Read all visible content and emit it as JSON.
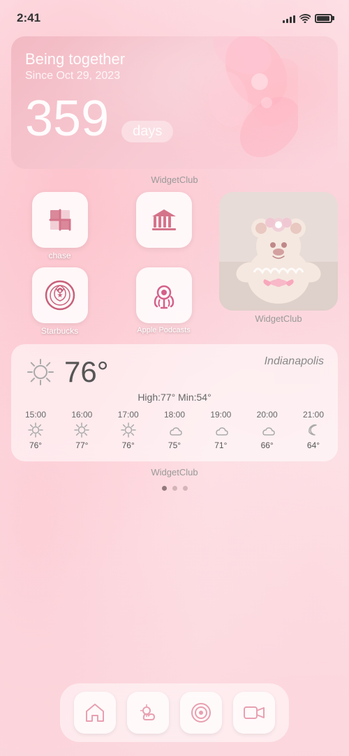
{
  "statusBar": {
    "time": "2:41",
    "signalBars": [
      3,
      5,
      7,
      9,
      11
    ],
    "batteryLevel": 85
  },
  "relationshipWidget": {
    "title": "Being together",
    "subtitle": "Since Oct 29, 2023",
    "count": "359",
    "unit": "days",
    "widgetclubLabel": "WidgetClub"
  },
  "appGrid": {
    "widgetclubLabel": "WidgetClub",
    "apps": [
      {
        "id": "chase",
        "label": "chase",
        "type": "chase"
      },
      {
        "id": "bank",
        "label": "",
        "type": "bank"
      },
      {
        "id": "starbucks",
        "label": "Starbucks",
        "type": "starbucks"
      },
      {
        "id": "podcasts",
        "label": "Apple Podcasts",
        "type": "podcasts"
      }
    ],
    "photoWidgetLabel": "WidgetClub"
  },
  "weather": {
    "city": "Indianapolis",
    "temp": "76°",
    "highLow": "High:77° Min:54°",
    "widgetclubLabel": "WidgetClub",
    "hourly": [
      {
        "time": "15:00",
        "icon": "sun",
        "temp": "76°"
      },
      {
        "time": "16:00",
        "icon": "sun",
        "temp": "77°"
      },
      {
        "time": "17:00",
        "icon": "sun",
        "temp": "76°"
      },
      {
        "time": "18:00",
        "icon": "cloud",
        "temp": "75°"
      },
      {
        "time": "19:00",
        "icon": "cloud",
        "temp": "71°"
      },
      {
        "time": "20:00",
        "icon": "cloud",
        "temp": "66°"
      },
      {
        "time": "21:00",
        "icon": "moon",
        "temp": "64°"
      }
    ]
  },
  "dock": {
    "icons": [
      {
        "id": "home",
        "type": "home"
      },
      {
        "id": "weather",
        "type": "weather"
      },
      {
        "id": "target",
        "type": "target"
      },
      {
        "id": "video",
        "type": "video"
      }
    ]
  }
}
